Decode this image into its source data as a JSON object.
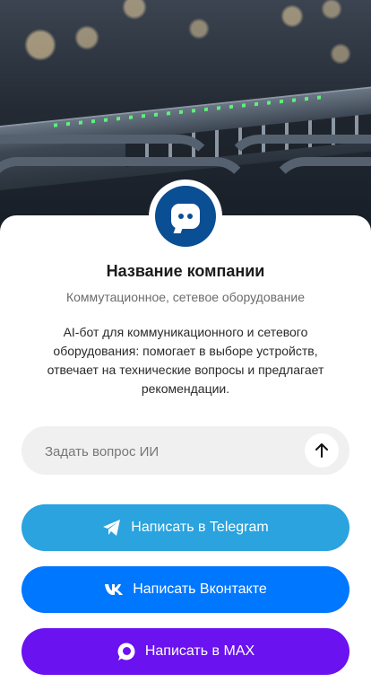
{
  "company": {
    "name": "Название компании",
    "category": "Коммутационное, сетевое оборудование",
    "description": "AI-бот для коммуникационного и сетевого оборудования: помогает в выборе устройств, отвечает на технические вопросы и предлагает рекомендации."
  },
  "ask": {
    "placeholder": "Задать вопрос ИИ"
  },
  "buttons": {
    "telegram": "Написать в Telegram",
    "vk": "Написать Вконтакте",
    "max": "Написать в MAX"
  },
  "icons": {
    "avatar": "chat-bot-icon",
    "send": "arrow-up-icon",
    "telegram": "telegram-icon",
    "vk": "vk-icon",
    "max": "max-icon"
  },
  "colors": {
    "avatar": "#0a4e93",
    "telegram": "#2aa3de",
    "vk": "#0077ff",
    "max": "#6a12ef"
  }
}
